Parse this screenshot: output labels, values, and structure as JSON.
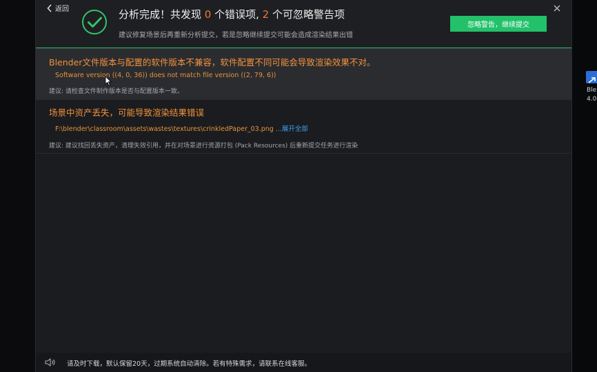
{
  "header": {
    "back_label": "返回",
    "title_prefix": "分析完成！共发现 ",
    "error_count": "0",
    "title_middle": " 个错误项, ",
    "warning_count": "2",
    "title_suffix": " 个可忽略警告项",
    "subtitle": "建议修复场景后再重新分析提交，若是忽略继续提交可能会造成渲染结果出错",
    "ignore_button": "忽略警告，继续提交"
  },
  "issues": [
    {
      "title": "Blender文件版本与配置的软件版本不兼容，软件配置不同可能会导致渲染效果不对。",
      "detail": "Software version ((4, 0, 36)) does not match file version ((2, 79, 6))",
      "link": "",
      "advice": "建议: 请检查文件制作版本是否与配置版本一致。"
    },
    {
      "title": "场景中资产丢失，可能导致渲染结果错误",
      "detail": "F:\\blender\\classroom\\assets\\wastes\\textures\\crinkledPaper_03.png",
      "link": "...展开全部",
      "advice": "建议: 建议找回丢失资产，清理失效引用，并在对场景进行资源打包 (Pack Resources) 后重新提交任务进行渲染"
    }
  ],
  "footer": {
    "notice": "请及时下载，默认保留20天，过期系统自动清除。若有特殊需求，请联系在线客服。"
  },
  "desktop": {
    "icon_label_1": "Ble",
    "icon_label_2": "4.0"
  },
  "colors": {
    "accent_green": "#22c16a",
    "warning_orange": "#f2923b",
    "link_blue": "#3d9ff5"
  }
}
